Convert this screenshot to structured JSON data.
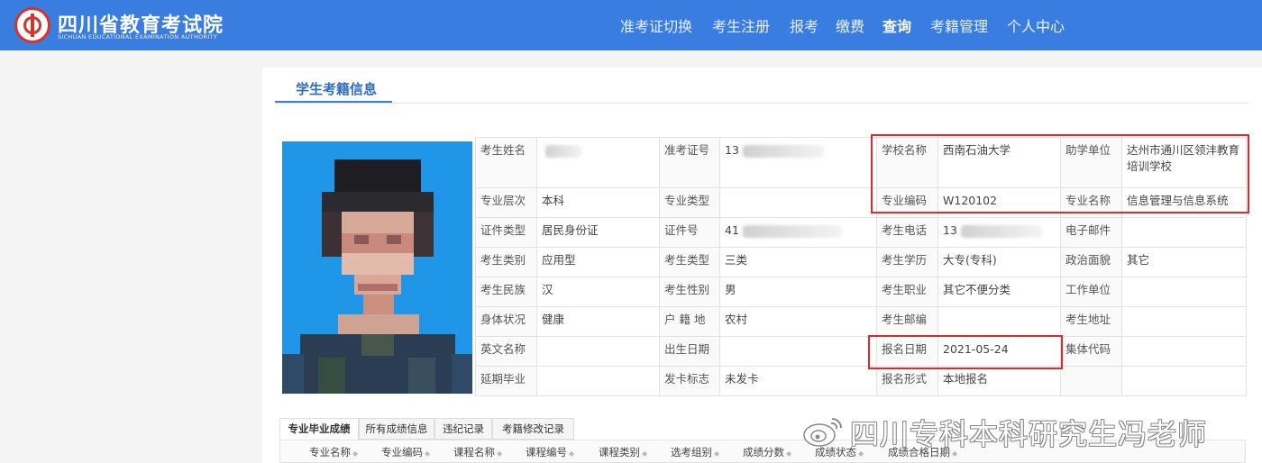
{
  "header": {
    "brand_cn": "四川省教育考试院",
    "brand_en": "SICHUAN EDUCATIONAL EXAMINATION AUTHORITY",
    "nav": [
      {
        "label": "准考证切换",
        "active": false
      },
      {
        "label": "考生注册",
        "active": false
      },
      {
        "label": "报考",
        "active": false
      },
      {
        "label": "缴费",
        "active": false
      },
      {
        "label": "查询",
        "active": true
      },
      {
        "label": "考籍管理",
        "active": false
      },
      {
        "label": "个人中心",
        "active": false
      }
    ]
  },
  "page_tab": "学生考籍信息",
  "info": {
    "name_label": "考生姓名",
    "exam_no_label": "准考证号",
    "exam_no_prefix": "13",
    "school_label": "学校名称",
    "school": "西南石油大学",
    "assist_label": "助学单位",
    "assist": "达州市通川区领沣教育培训学校",
    "level_label": "专业层次",
    "level": "本科",
    "major_type_label": "专业类型",
    "major_code_label": "专业编码",
    "major_code": "W120102",
    "major_name_label": "专业名称",
    "major_name": "信息管理与信息系统",
    "id_type_label": "证件类型",
    "id_type": "居民身份证",
    "id_no_label": "证件号",
    "id_no_prefix": "41",
    "phone_label": "考生电话",
    "phone_prefix": "13",
    "email_label": "电子邮件",
    "category_label": "考生类别",
    "category": "应用型",
    "student_type_label": "考生类型",
    "student_type": "三类",
    "education_label": "考生学历",
    "education": "大专(专科)",
    "politics_label": "政治面貌",
    "politics": "其它",
    "ethnic_label": "考生民族",
    "ethnic": "汉",
    "gender_label": "考生性别",
    "gender": "男",
    "occupation_label": "考生职业",
    "occupation": "其它不便分类",
    "workplace_label": "工作单位",
    "health_label": "身体状况",
    "health": "健康",
    "hukou_label": "户 籍 地",
    "hukou": "农村",
    "postcode_label": "考生邮编",
    "address_label": "考生地址",
    "english_name_label": "英文名称",
    "birth_label": "出生日期",
    "reg_date_label": "报名日期",
    "reg_date": "2021-05-24",
    "group_code_label": "集体代码",
    "delay_label": "延期毕业",
    "card_label": "发卡标志",
    "card": "未发卡",
    "reg_form_label": "报名形式",
    "reg_form": "本地报名"
  },
  "subtabs": [
    {
      "label": "专业毕业成绩",
      "active": true
    },
    {
      "label": "所有成绩信息",
      "active": false
    },
    {
      "label": "违纪记录",
      "active": false
    },
    {
      "label": "考籍修改记录",
      "active": false
    }
  ],
  "grid_columns": [
    "专业名称",
    "专业编码",
    "课程名称",
    "课程编号",
    "课程类别",
    "选考组别",
    "成绩分数",
    "成绩状态",
    "成绩合格日期"
  ],
  "watermark": "四川专科本科研究生冯老师",
  "colors": {
    "header_bg": "#3a7de0",
    "accent": "#2f6cc4",
    "highlight_box": "#e02a2a",
    "photo_bg": "#1f96e8"
  }
}
